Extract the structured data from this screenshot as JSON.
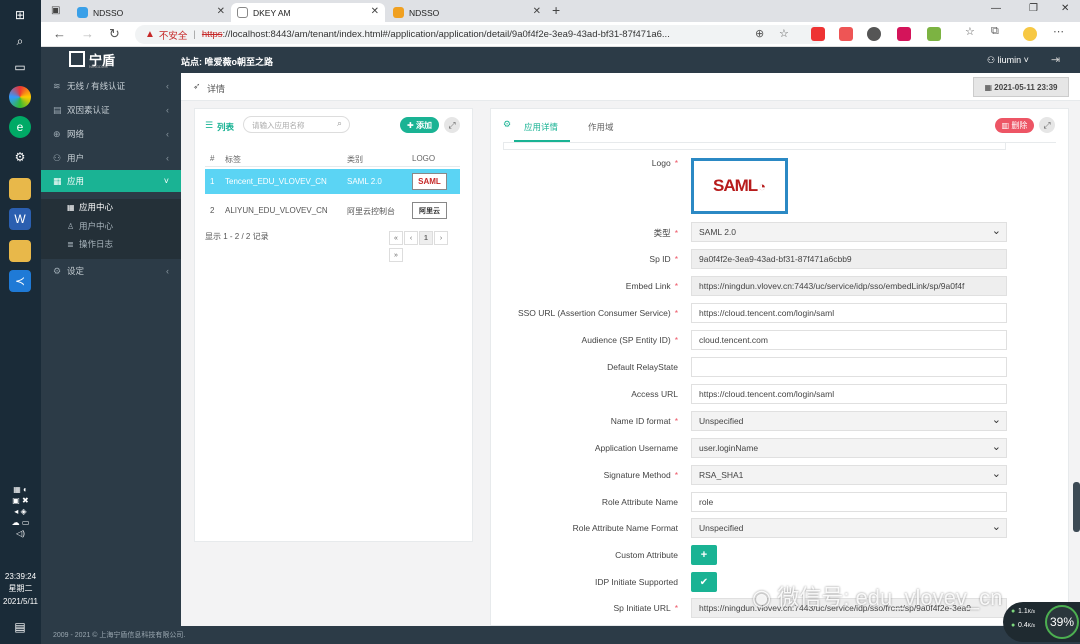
{
  "browser": {
    "tabs": [
      {
        "title": "NDSSO"
      },
      {
        "title": "DKEY AM"
      },
      {
        "title": "NDSSO"
      }
    ],
    "insecure_label": "不安全",
    "url_scheme": "https",
    "url_rest": "://localhost:8443/am/tenant/index.html#/application/application/detail/9a0f4f2e-3ea9-43ad-bf31-87f471a6..."
  },
  "taskbar": {
    "time": "23:39:24",
    "weekday": "星期二",
    "date": "2021/5/11"
  },
  "app": {
    "logo_text": "宁盾",
    "logo_sub": "NINGDUN",
    "site_label": "站点: 唯爱薇o朝至之路",
    "user": "liumin",
    "footer": "2009 - 2021 © 上海宁盾信息科技有限公司."
  },
  "sidebar": {
    "items": [
      {
        "label": "无线 / 有线认证",
        "icon": "wifi-icon"
      },
      {
        "label": "双因素认证",
        "icon": "shield-icon"
      },
      {
        "label": "网络",
        "icon": "globe-icon"
      },
      {
        "label": "用户",
        "icon": "users-icon"
      },
      {
        "label": "应用",
        "icon": "grid-icon"
      },
      {
        "label": "设定",
        "icon": "gear-icon"
      }
    ],
    "subitems": [
      {
        "label": "应用中心"
      },
      {
        "label": "用户中心"
      },
      {
        "label": "操作日志"
      }
    ]
  },
  "breadcrumb": {
    "label": "详情",
    "datetime": "2021-05-11 23:39"
  },
  "list_panel": {
    "title": "列表",
    "search_placeholder": "请输入应用名称",
    "add_label": "添加",
    "columns": [
      "#",
      "标签",
      "类别",
      "LOGO"
    ],
    "rows": [
      {
        "num": "1",
        "label": "Tencent_EDU_VLOVEV_CN",
        "category": "SAML 2.0",
        "logo": "SAML"
      },
      {
        "num": "2",
        "label": "ALIYUN_EDU_VLOVEV_CN",
        "category": "阿里云控制台",
        "logo": "阿里云"
      }
    ],
    "summary": "显示 1 - 2 / 2 记录",
    "pager": [
      "«",
      "‹",
      "1",
      "›",
      "»"
    ]
  },
  "detail_panel": {
    "tabs": [
      "应用详情",
      "作用域"
    ],
    "delete_label": "删除",
    "logo_text": "SAML",
    "fields": [
      {
        "label": "Logo",
        "required": true
      },
      {
        "label": "类型",
        "required": true,
        "value": "SAML 2.0",
        "kind": "select"
      },
      {
        "label": "Sp ID",
        "required": true,
        "value": "9a0f4f2e-3ea9-43ad-bf31-87f471a6cbb9",
        "kind": "readonly"
      },
      {
        "label": "Embed Link",
        "required": true,
        "value": "https://ningdun.vlovev.cn:7443/uc/service/idp/sso/embedLink/sp/9a0f4f",
        "kind": "readonly"
      },
      {
        "label": "SSO URL (Assertion Consumer Service)",
        "required": true,
        "value": "https://cloud.tencent.com/login/saml",
        "kind": "text"
      },
      {
        "label": "Audience (SP Entity ID)",
        "required": true,
        "value": "cloud.tencent.com",
        "kind": "text"
      },
      {
        "label": "Default RelayState",
        "required": false,
        "value": "",
        "kind": "text"
      },
      {
        "label": "Access URL",
        "required": false,
        "value": "https://cloud.tencent.com/login/saml",
        "kind": "text"
      },
      {
        "label": "Name ID format",
        "required": true,
        "value": "Unspecified",
        "kind": "select"
      },
      {
        "label": "Application Username",
        "required": false,
        "value": "user.loginName",
        "kind": "select"
      },
      {
        "label": "Signature Method",
        "required": true,
        "value": "RSA_SHA1",
        "kind": "select"
      },
      {
        "label": "Role Attribute Name",
        "required": false,
        "value": "role",
        "kind": "text"
      },
      {
        "label": "Role Attribute Name Format",
        "required": false,
        "value": "Unspecified",
        "kind": "select"
      },
      {
        "label": "Custom Attribute",
        "required": false,
        "kind": "add-button"
      },
      {
        "label": "IDP Initiate Supported",
        "required": false,
        "kind": "checkbox"
      },
      {
        "label": "Sp Initiate URL",
        "required": true,
        "value": "https://ningdun.vlovev.cn:7443/uc/service/idp/sso/front/sp/9a0f4f2e-3ea9-",
        "kind": "readonly"
      }
    ]
  },
  "overlay": {
    "watermark": "微信号: edu_vlovev_cn",
    "net_up": "1.1",
    "net_down": "0.4",
    "net_unit": "K/s",
    "cpu_percent": "39%"
  }
}
